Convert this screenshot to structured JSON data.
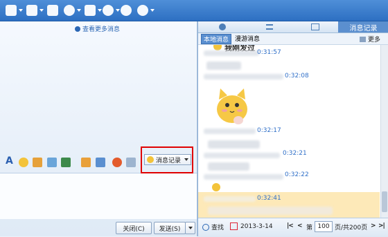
{
  "toolbar": {
    "icons": [
      "home-icon",
      "inbox-icon",
      "window-icon",
      "music-icon",
      "clipboard-icon",
      "camera-icon",
      "chat-icon",
      "gear-icon"
    ]
  },
  "left": {
    "more_link": "查看更多消息",
    "records_button": "消息记录",
    "close_button": "关闭(C)",
    "send_button": "发送(S)"
  },
  "right": {
    "tab_records": "消息记录",
    "subtab_local": "本地消息",
    "subtab_roaming": "漫游消息",
    "more": "更多",
    "partial_text": "我刚发过",
    "times": [
      "0:31:57",
      "0:32:08",
      "0:32:17",
      "0:32:21",
      "0:32:22",
      "0:32:41"
    ],
    "search": "查找",
    "date": "2013-3-14",
    "page_prefix": "第",
    "page_value": "100",
    "page_suffix": "页/共200页"
  },
  "colors": {
    "accent": "#2d6fc2",
    "highlight": "#e00000",
    "time": "#2f6fc8"
  }
}
